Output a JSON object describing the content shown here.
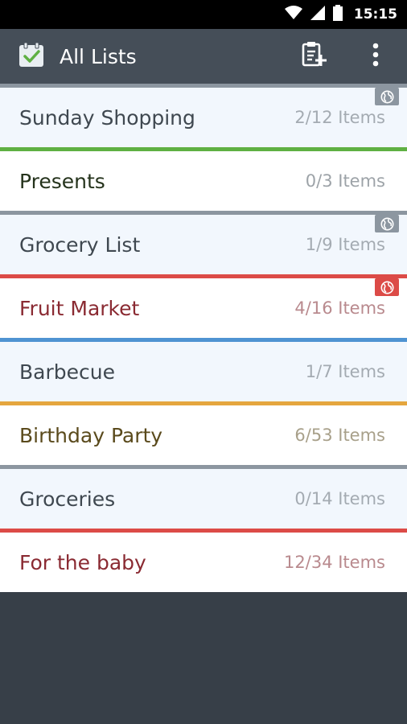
{
  "status_bar": {
    "time": "15:15"
  },
  "app_bar": {
    "title": "All Lists",
    "app_icon": "clipboard-check-icon",
    "actions": [
      "add-list-icon",
      "overflow-menu-icon"
    ]
  },
  "lists": [
    {
      "name": "Sunday Shopping",
      "count": "2/12 Items",
      "bar_color": "#8c96a0",
      "bg": "light",
      "name_color": "#3f4850",
      "count_color": "#a4abb2",
      "shared": true,
      "share_color": "#8c96a0"
    },
    {
      "name": "Presents",
      "count": "0/3 Items",
      "bar_color": "#5fb043",
      "bg": "white",
      "name_color": "#25331c",
      "count_color": "#9da3a8",
      "shared": false
    },
    {
      "name": "Grocery List",
      "count": "1/9 Items",
      "bar_color": "#8c96a0",
      "bg": "light",
      "name_color": "#3f4850",
      "count_color": "#a4abb2",
      "shared": true,
      "share_color": "#8c96a0"
    },
    {
      "name": "Fruit Market",
      "count": "4/16 Items",
      "bar_color": "#dc4b47",
      "bg": "white",
      "name_color": "#8a2a32",
      "count_color": "#b98a8e",
      "shared": true,
      "share_color": "#dc4b47"
    },
    {
      "name": "Barbecue",
      "count": "1/7 Items",
      "bar_color": "#4f93d2",
      "bg": "light",
      "name_color": "#3f4850",
      "count_color": "#a4abb2",
      "shared": false
    },
    {
      "name": "Birthday Party",
      "count": "6/53 Items",
      "bar_color": "#e5a63e",
      "bg": "white",
      "name_color": "#5a4a1c",
      "count_color": "#a8a08a",
      "shared": false
    },
    {
      "name": "Groceries",
      "count": "0/14 Items",
      "bar_color": "#8c96a0",
      "bg": "light",
      "name_color": "#3f4850",
      "count_color": "#a4abb2",
      "shared": false
    },
    {
      "name": "For the baby",
      "count": "12/34 Items",
      "bar_color": "#dc4b47",
      "bg": "white",
      "name_color": "#8a2a32",
      "count_color": "#b98a8e",
      "shared": false
    }
  ]
}
